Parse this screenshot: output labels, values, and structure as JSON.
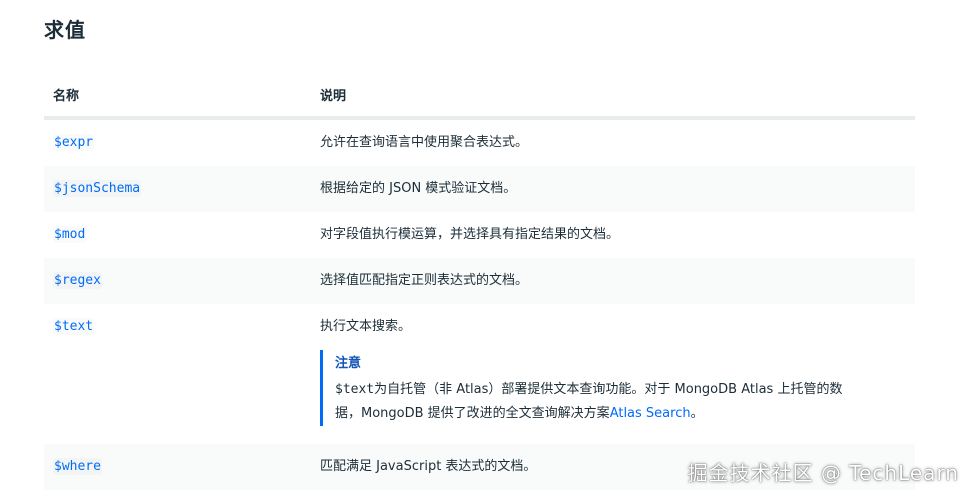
{
  "title": "求值",
  "table": {
    "headers": {
      "name": "名称",
      "description": "说明"
    },
    "rows": [
      {
        "name": "$expr",
        "description": "允许在查询语言中使用聚合表达式。"
      },
      {
        "name": "$jsonSchema",
        "description": "根据给定的 JSON 模式验证文档。"
      },
      {
        "name": "$mod",
        "description": "对字段值执行模运算，并选择具有指定结果的文档。"
      },
      {
        "name": "$regex",
        "description": "选择值匹配指定正则表达式的文档。"
      },
      {
        "name": "$text",
        "description": "执行文本搜索。"
      },
      {
        "name": "$where",
        "description": "匹配满足 JavaScript 表达式的文档。"
      }
    ]
  },
  "note": {
    "title": "注意",
    "code": "$text",
    "body_line1": "为自托管（非 Atlas）部署提供文本查询功能。对于 MongoDB Atlas 上托管的数",
    "body_line2": "据，MongoDB 提供了改进的全文查询解决方案",
    "link": "Atlas Search",
    "end": "。"
  },
  "watermark": "掘金技术社区 @ TechLearn",
  "colors": {
    "link": "#016bf8",
    "note_title": "#1254b7",
    "text": "#1c2d38",
    "row_alt_bg": "#f9fbfa",
    "header_border": "#e8edeb"
  }
}
